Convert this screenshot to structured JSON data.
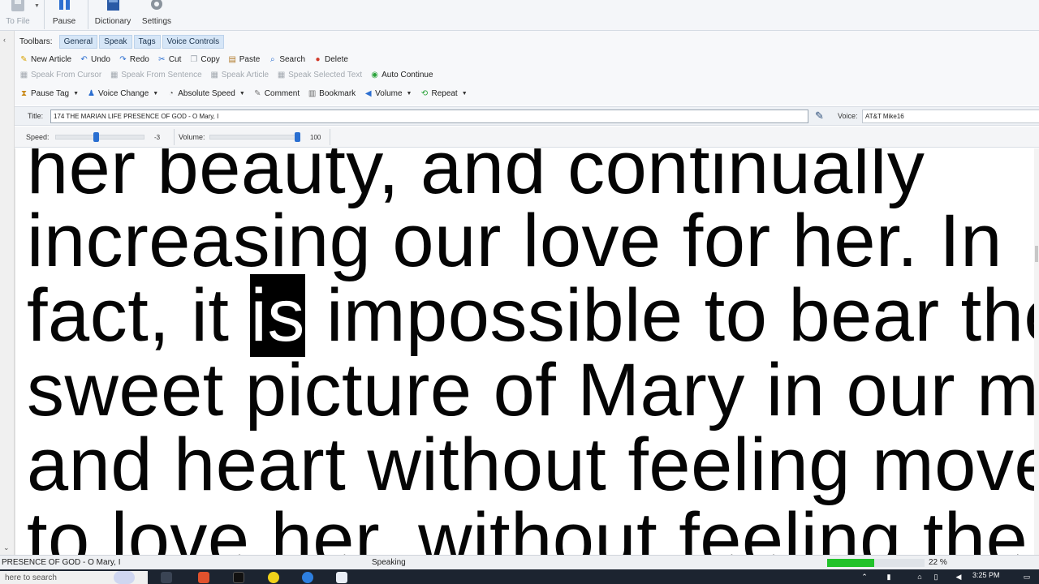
{
  "ribbon": {
    "buttons": [
      {
        "label": "To File",
        "icon": "save-to-file-icon",
        "dim": true
      },
      {
        "label": "Pause",
        "icon": "pause-icon"
      },
      {
        "label": "Dictionary",
        "icon": "dictionary-icon"
      },
      {
        "label": "Settings",
        "icon": "gear-icon"
      }
    ]
  },
  "toolbars": {
    "label": "Toolbars:",
    "tabs": [
      "General",
      "Speak",
      "Tags",
      "Voice Controls"
    ],
    "row1": [
      "New Article",
      "Undo",
      "Redo",
      "Cut",
      "Copy",
      "Paste",
      "Search",
      "Delete"
    ],
    "row2": [
      "Speak From Cursor",
      "Speak From Sentence",
      "Speak Article",
      "Speak Selected Text",
      "Auto Continue"
    ],
    "row3": [
      "Pause Tag",
      "Voice Change",
      "Absolute Speed",
      "Comment",
      "Bookmark",
      "Volume",
      "Repeat"
    ]
  },
  "title_row": {
    "title_label": "Title:",
    "title_value": "174 THE MARIAN LIFE PRESENCE OF GOD - O Mary, I",
    "voice_label": "Voice:",
    "voice_value": "AT&T Mike16"
  },
  "sliders": {
    "speed_label": "Speed:",
    "speed_value": "-3",
    "speed_level": 0.45,
    "volume_label": "Volume:",
    "volume_value": "100",
    "volume_level": 1.0
  },
  "reader": {
    "line0": "her beauty, and continually",
    "line1": "increasing our love for her. In",
    "line2_pre": "fact, it ",
    "line2_hl": "is",
    "line2_post": " impossible to bear the",
    "line3": "sweet picture of Mary in our mind",
    "line4": "and heart without feeling moved",
    "line5": "to love her, without feeling the"
  },
  "status": {
    "article": "PRESENCE OF GOD - O Mary, I",
    "state": "Speaking",
    "progress_percent": "22 %",
    "progress_fraction": 0.48
  },
  "taskbar": {
    "search_placeholder": "here to search",
    "time": "3:25 PM"
  }
}
